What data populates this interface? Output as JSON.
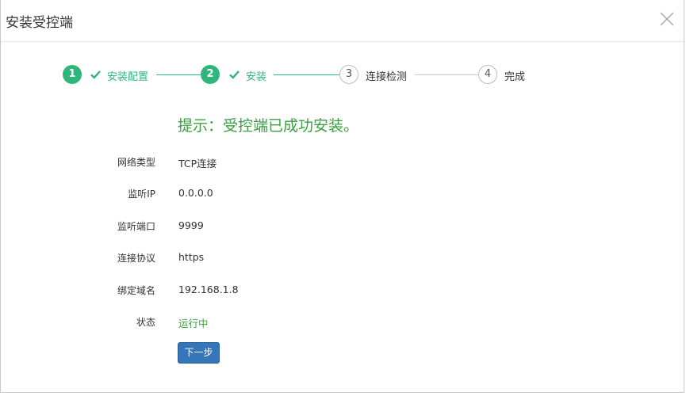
{
  "dialog": {
    "title": "安装受控端"
  },
  "steps": [
    {
      "number": "1",
      "label": "安装配置",
      "state": "done"
    },
    {
      "number": "2",
      "label": "安装",
      "state": "done"
    },
    {
      "number": "3",
      "label": "连接检测",
      "state": "todo"
    },
    {
      "number": "4",
      "label": "完成",
      "state": "todo"
    }
  ],
  "hint": "提示：受控端已成功安装。",
  "fields": [
    {
      "label": "网络类型",
      "value": "TCP连接"
    },
    {
      "label": "监听IP",
      "value": "0.0.0.0"
    },
    {
      "label": "监听端口",
      "value": "9999"
    },
    {
      "label": "连接协议",
      "value": "https"
    },
    {
      "label": "绑定域名",
      "value": "192.168.1.8"
    },
    {
      "label": "状态",
      "value": "运行中"
    }
  ],
  "next_button": "下一步",
  "colors": {
    "accent_green": "#2fb67a",
    "hint_green": "#3aa041",
    "button_blue": "#3476b8"
  }
}
